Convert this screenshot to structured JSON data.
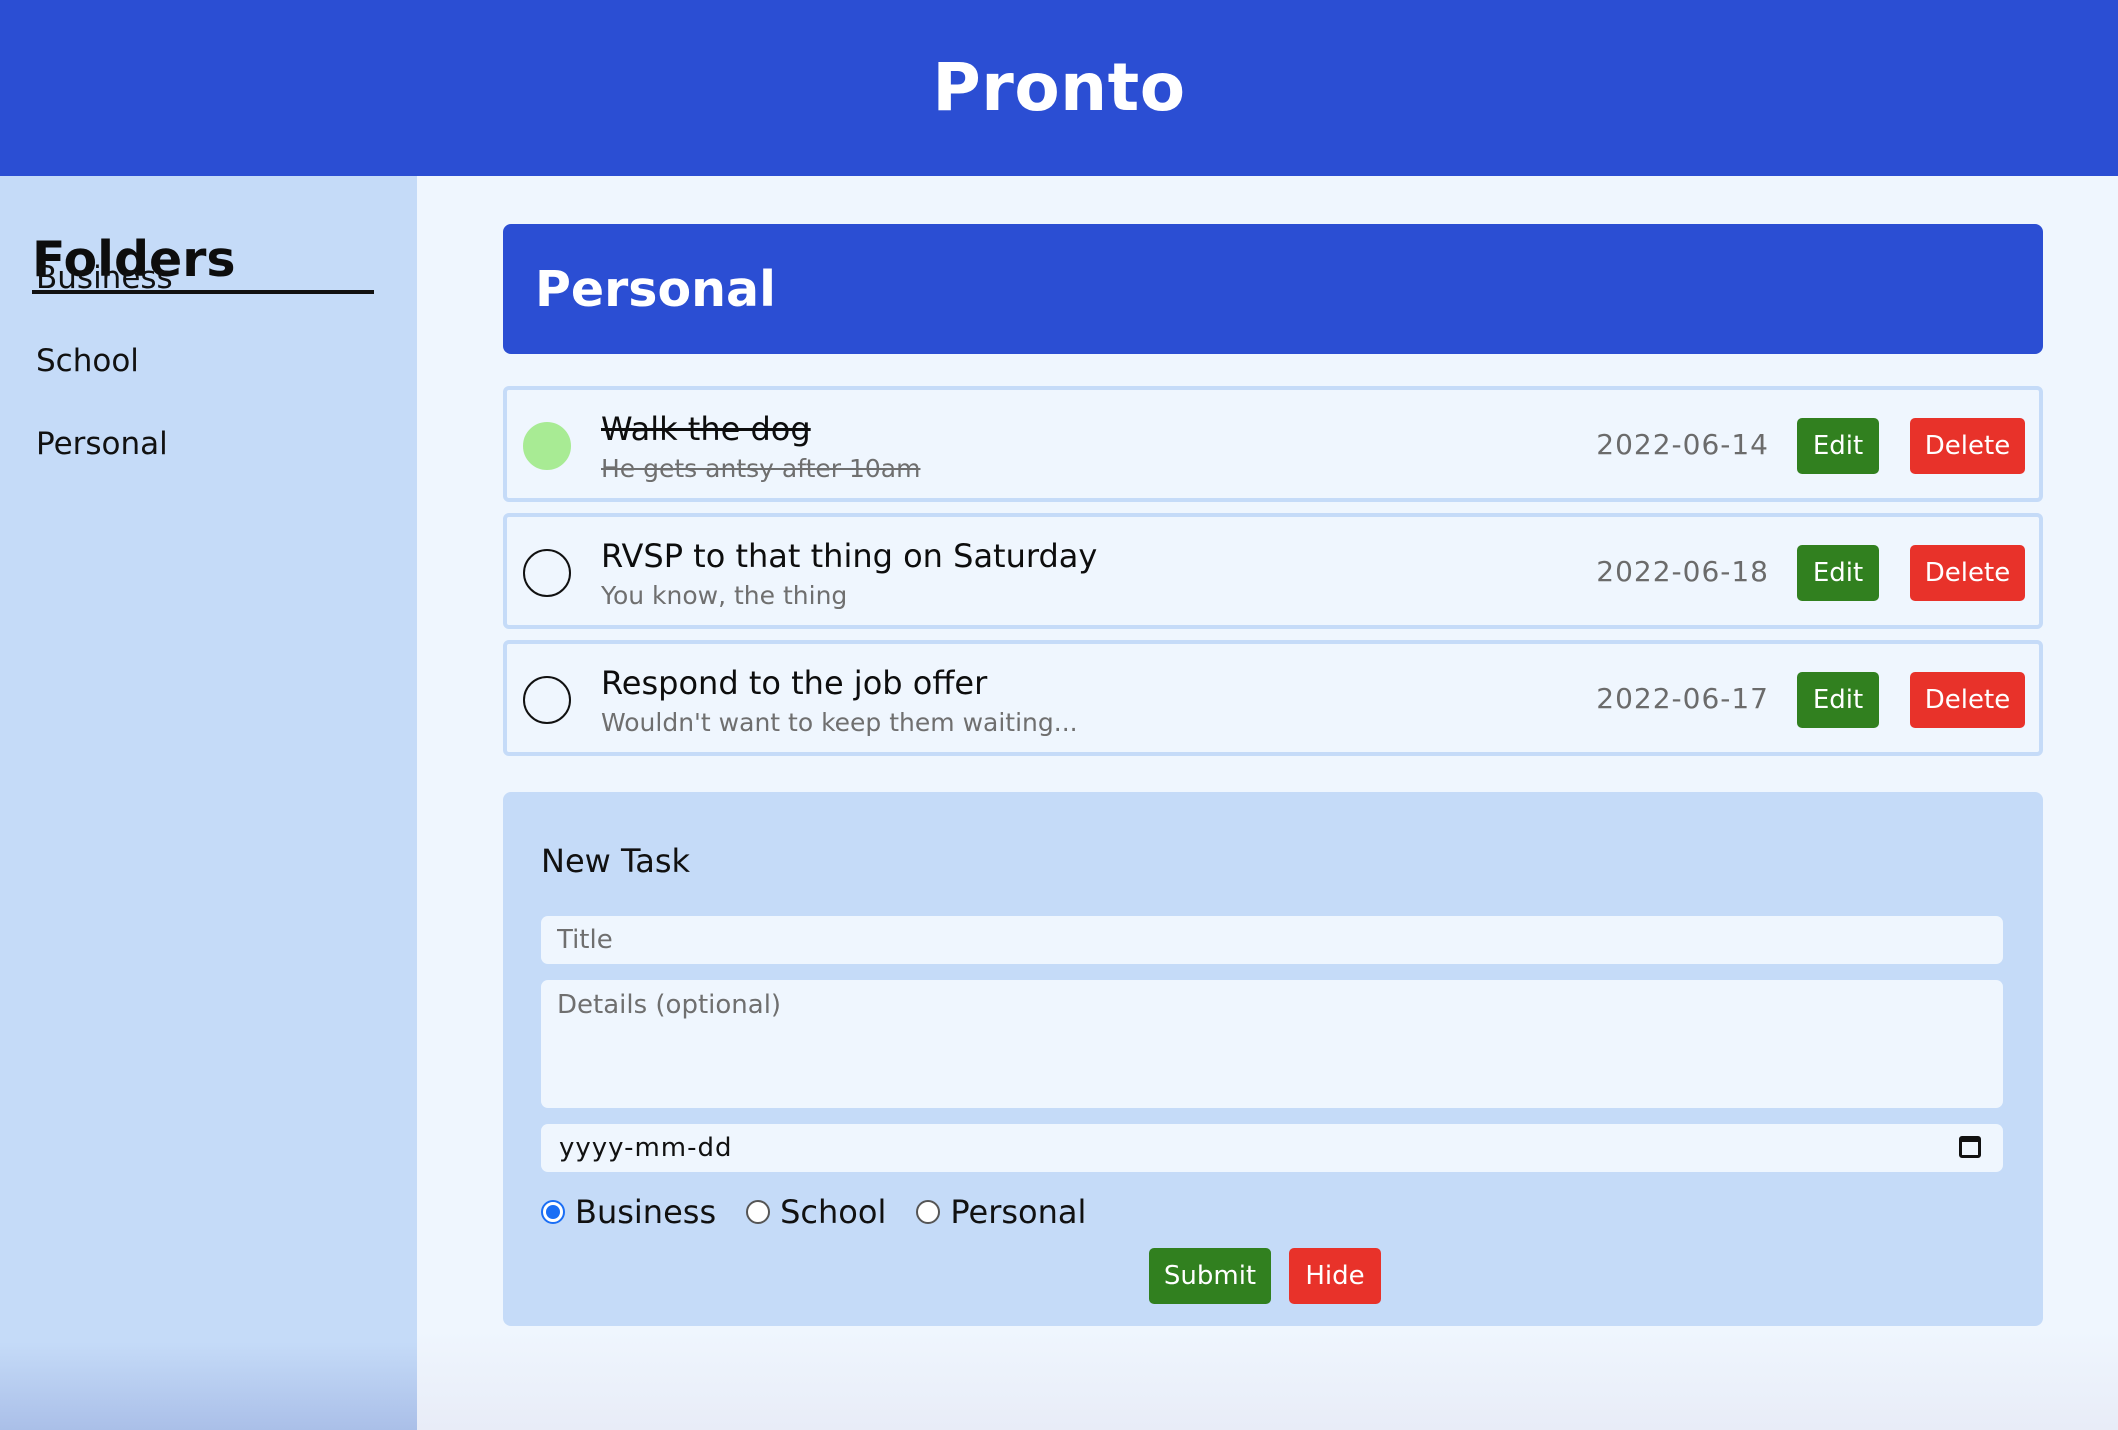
{
  "app": {
    "title": "Pronto"
  },
  "sidebar": {
    "heading": "Folders",
    "items": [
      {
        "label": "Business"
      },
      {
        "label": "School"
      },
      {
        "label": "Personal"
      }
    ]
  },
  "folder": {
    "title": "Personal"
  },
  "tasks": [
    {
      "title": "Walk the dog",
      "details": "He gets antsy after 10am",
      "date": "2022-06-14",
      "completed": true
    },
    {
      "title": "RVSP to that thing on Saturday",
      "details": "You know, the thing",
      "date": "2022-06-18",
      "completed": false
    },
    {
      "title": "Respond to the job offer",
      "details": "Wouldn't want to keep them waiting...",
      "date": "2022-06-17",
      "completed": false
    }
  ],
  "task_actions": {
    "edit_label": "Edit",
    "delete_label": "Delete"
  },
  "new_task": {
    "heading": "New Task",
    "title_placeholder": "Title",
    "details_placeholder": "Details (optional)",
    "date_placeholder": "yyyy-mm-dd",
    "folder_options": [
      {
        "label": "Business",
        "selected": true
      },
      {
        "label": "School",
        "selected": false
      },
      {
        "label": "Personal",
        "selected": false
      }
    ],
    "submit_label": "Submit",
    "hide_label": "Hide"
  },
  "colors": {
    "brand_blue": "#2b4ed3",
    "sidebar_bg": "#c5dbf8",
    "edit_green": "#31801f",
    "delete_red": "#e8322a",
    "done_green": "#a8eb94"
  }
}
